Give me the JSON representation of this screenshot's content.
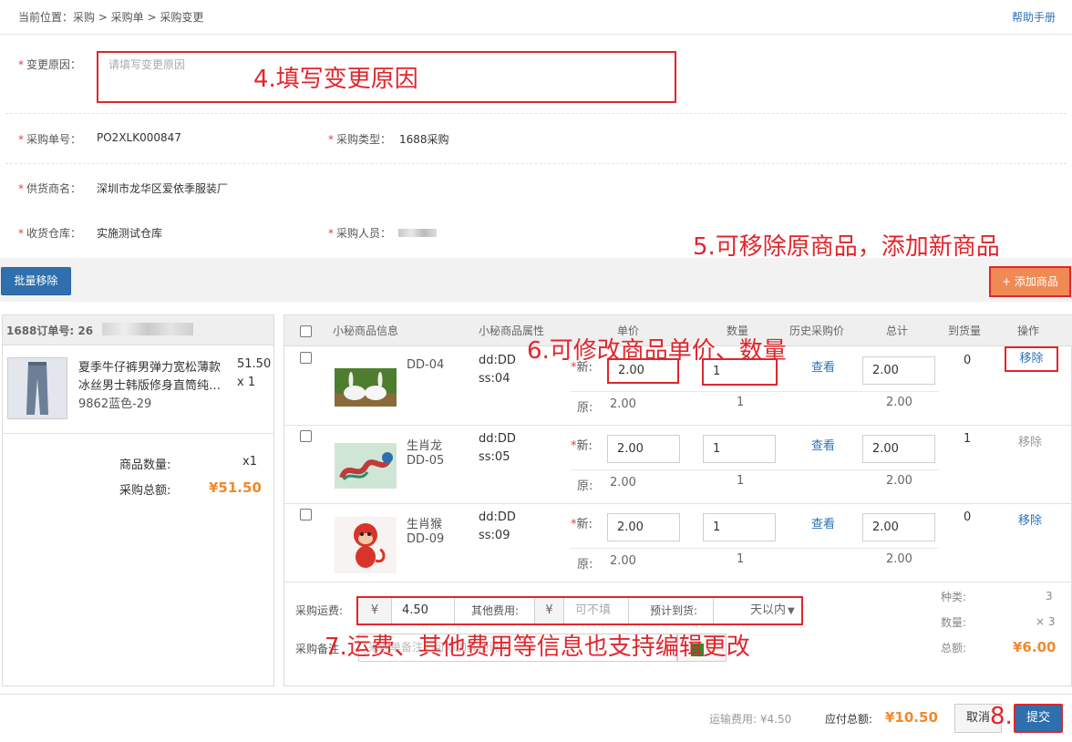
{
  "breadcrumb": "当前位置：采购 > 采购单 > 采购变更",
  "help_link": "帮助手册",
  "form": {
    "reason_label": "变更原因：",
    "reason_placeholder": "请填写变更原因",
    "po_label": "采购单号：",
    "po_value": "PO2XLK000847",
    "type_label": "采购类型：",
    "type_value": "1688采购",
    "supplier_label": "供货商名：",
    "supplier_value": "深圳市龙华区爱依季服装厂",
    "warehouse_label": "收货仓库：",
    "warehouse_value": "实施测试仓库",
    "buyer_label": "采购人员："
  },
  "annotations": {
    "a4": "4.填写变更原因",
    "a5": "5.可移除原商品，添加新商品",
    "a6": "6.可修改商品单价、数量",
    "a7": "7.运费、其他费用等信息也支持编辑更改",
    "a8": "8."
  },
  "toolbar": {
    "batch_remove": "批量移除",
    "add_product": "+ 添加商品"
  },
  "left": {
    "order_label": "1688订单号: 26",
    "product_name_line1": "夏季牛仔裤男弹力宽松薄款",
    "product_name_line2": "冰丝男士韩版修身直筒纯…",
    "product_sku": "9862蓝色-29",
    "price": "51.50",
    "qty": "x 1",
    "count_label": "商品数量:",
    "count_value": "x1",
    "total_label": "采购总额:",
    "total_value": "¥51.50"
  },
  "table": {
    "headers": [
      "小秘商品信息",
      "小秘商品属性",
      "单价",
      "数量",
      "历史采购价",
      "总计",
      "到货量",
      "操作"
    ],
    "new_label": "新:",
    "orig_label": "原:",
    "view_label": "查看",
    "remove_label": "移除",
    "rows": [
      {
        "name": "",
        "code": "DD-04",
        "attr1": "dd:DD",
        "attr2": "ss:04",
        "price": "2.00",
        "qty": "1",
        "total": "2.00",
        "orig_price": "2.00",
        "orig_qty": "1",
        "orig_total": "2.00",
        "arrived": "0"
      },
      {
        "name": "生肖龙",
        "code": "DD-05",
        "attr1": "dd:DD",
        "attr2": "ss:05",
        "price": "2.00",
        "qty": "1",
        "total": "2.00",
        "orig_price": "2.00",
        "orig_qty": "1",
        "orig_total": "2.00",
        "arrived": "1"
      },
      {
        "name": "生肖猴",
        "code": "DD-09",
        "attr1": "dd:DD",
        "attr2": "ss:09",
        "price": "2.00",
        "qty": "1",
        "total": "2.00",
        "orig_price": "2.00",
        "orig_qty": "1",
        "orig_total": "2.00",
        "arrived": "0"
      }
    ]
  },
  "fees": {
    "shipping_label": "采购运费:",
    "currency": "¥",
    "shipping_value": "4.50",
    "other_label": "其他费用:",
    "other_placeholder": "可不填",
    "eta_label": "预计到货:",
    "eta_value": "天以内",
    "remark_label": "采购备注",
    "remark_placeholder": "采购单备注，可添加其他说明"
  },
  "summary": {
    "kinds_label": "种类:",
    "kinds_value": "3",
    "qty_label": "数量:",
    "qty_value": "× 3",
    "total_label": "总额:",
    "total_value": "¥6.00"
  },
  "footer": {
    "shipping_text": "运输费用: ¥4.50",
    "payable_label": "应付总额:",
    "payable_value": "¥10.50",
    "cancel": "取消",
    "submit": "提交"
  },
  "colors": {
    "accent": "#2f6fad",
    "annotation": "#e0262c",
    "orange": "#f08a2c"
  }
}
